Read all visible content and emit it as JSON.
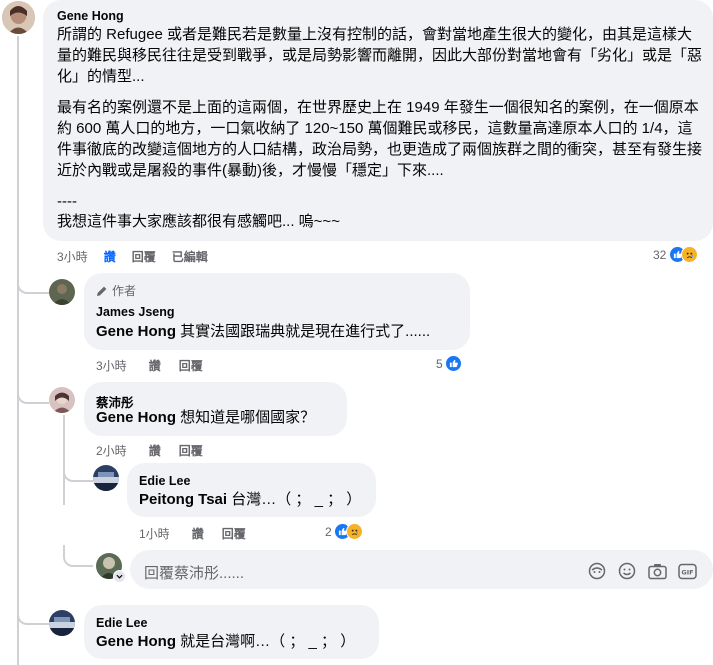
{
  "main_comment": {
    "author": "Gene Hong",
    "paragraph1": "所謂的 Refugee 或者是難民若是數量上沒有控制的話，會對當地產生很大的變化，由其是這樣大量的難民與移民往往是受到戰爭，或是局勢影響而離開，因此大部份對當地會有「劣化」或是「惡化」的情型...",
    "paragraph2": "最有名的案例還不是上面的這兩個，在世界歷史上在 1949 年發生一個很知名的案例，在一個原本約 600 萬人口的地方，一口氣收納了 120~150 萬個難民或移民，這數量高達原本人口的 1/4，這件事徹底的改變這個地方的人口結構，政治局勢，也更造成了兩個族群之間的衝突，甚至有發生接近於內戰或是屠殺的事件(暴動)後，才慢慢「穩定」下來....",
    "separator": "----",
    "paragraph3": "我想這件事大家應該都很有感觸吧... 嗚~~~",
    "time": "3小時",
    "like_label": "讚",
    "reply_label": "回覆",
    "edited_label": "已編輯",
    "reaction_count": "32"
  },
  "reply1": {
    "badge": "作者",
    "author": "James Jseng",
    "tag": "Gene Hong",
    "text": " 其實法國跟瑞典就是現在進行式了......",
    "time": "3小時",
    "like_label": "讚",
    "reply_label": "回覆",
    "reaction_count": "5"
  },
  "reply2": {
    "author": "蔡沛彤",
    "tag": "Gene Hong",
    "text": " 想知道是哪個國家？",
    "time": "2小時",
    "like_label": "讚",
    "reply_label": "回覆"
  },
  "reply2_sub": {
    "author": "Edie Lee",
    "tag": "Peitong Tsai",
    "text": " 台灣…（ ； _ ； ）",
    "time": "1小時",
    "like_label": "讚",
    "reply_label": "回覆",
    "reaction_count": "2"
  },
  "reply_box": {
    "placeholder": "回覆蔡沛彤......"
  },
  "reply3": {
    "author": "Edie Lee",
    "tag": "Gene Hong",
    "text": " 就是台灣啊…（ ； _ ； ）"
  }
}
